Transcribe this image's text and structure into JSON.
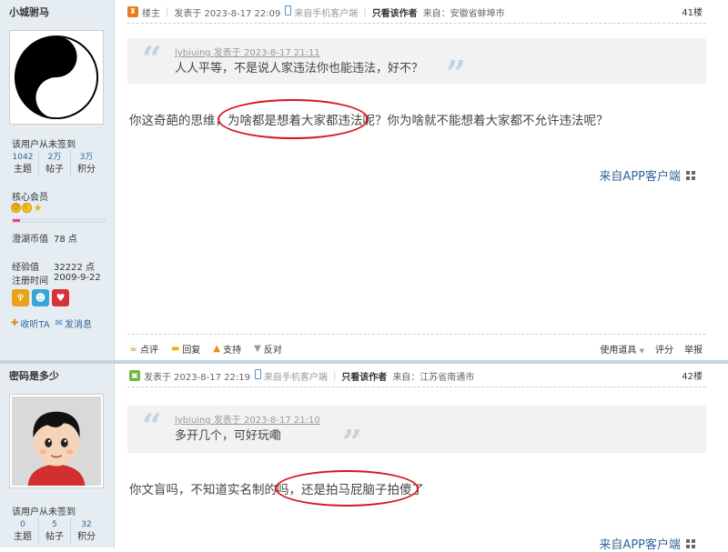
{
  "post1": {
    "username": "小城驸马",
    "sign_status": "该用户从未签到",
    "stats": [
      {
        "num": "1042",
        "label": "主题"
      },
      {
        "num": "2万",
        "label": "帖子"
      },
      {
        "num": "3万",
        "label": "积分"
      }
    ],
    "group": "核心会员",
    "level_progress": 0.08,
    "currency": {
      "label": "澄湖币值",
      "value": "78 点"
    },
    "experience": {
      "label": "经验值",
      "value": "32222 点"
    },
    "register": {
      "label": "注册时间",
      "value": "2009-9-22"
    },
    "follow_label": "收听TA",
    "message_label": "发消息",
    "role": "楼主",
    "posted_at": "发表于  2023-8-17 22:09",
    "client": "来自手机客户端",
    "only_author": "只看该作者",
    "location": "来自：安徽省蚌埠市",
    "floor": "41楼",
    "quote": {
      "author_line": "lybiuing 发表于 2023-8-17 21:11",
      "text": "人人平等，不是说人家违法你也能违法，好不？"
    },
    "body": "你这奇葩的思维，为啥都是想着大家都违法呢？你为啥就不能想着大家都不允许违法呢？",
    "app_link": "来自APP客户端",
    "actions": {
      "rate": "点评",
      "reply": "回复",
      "support": "支持",
      "oppose": "反对"
    },
    "tools": {
      "props": "使用道具",
      "score": "评分",
      "report": "举报"
    }
  },
  "post2": {
    "username": "密码是多少",
    "sign_status": "该用户从未签到",
    "stats": [
      {
        "num": "0",
        "label": "主题"
      },
      {
        "num": "5",
        "label": "帖子"
      },
      {
        "num": "32",
        "label": "积分"
      }
    ],
    "posted_at": "发表于  2023-8-17 22:19",
    "client": "来自手机客户端",
    "only_author": "只看该作者",
    "location": "来自：江苏省南通市",
    "floor": "42楼",
    "quote": {
      "author_line": "lybiuing 发表于 2023-8-17 21:10",
      "text": "多开几个，可好玩嘞"
    },
    "body": "你文盲吗，不知道实名制的吗，还是拍马屁脑子拍傻了",
    "app_link": "来自APP客户端"
  },
  "colors": {
    "sidebar_bg": "#e5edf2",
    "link": "#336699",
    "annotation_red": "#d6161d",
    "progress_pink": "#ee3d8f"
  },
  "icons": [
    "yin-yang-avatar",
    "cartoon-boy-avatar",
    "landlord-icon",
    "phone-icon",
    "follow-icon",
    "mail-icon",
    "comment-icon",
    "reply-icon",
    "thumb-up-icon",
    "thumb-down-icon",
    "qr-grid-icon"
  ]
}
